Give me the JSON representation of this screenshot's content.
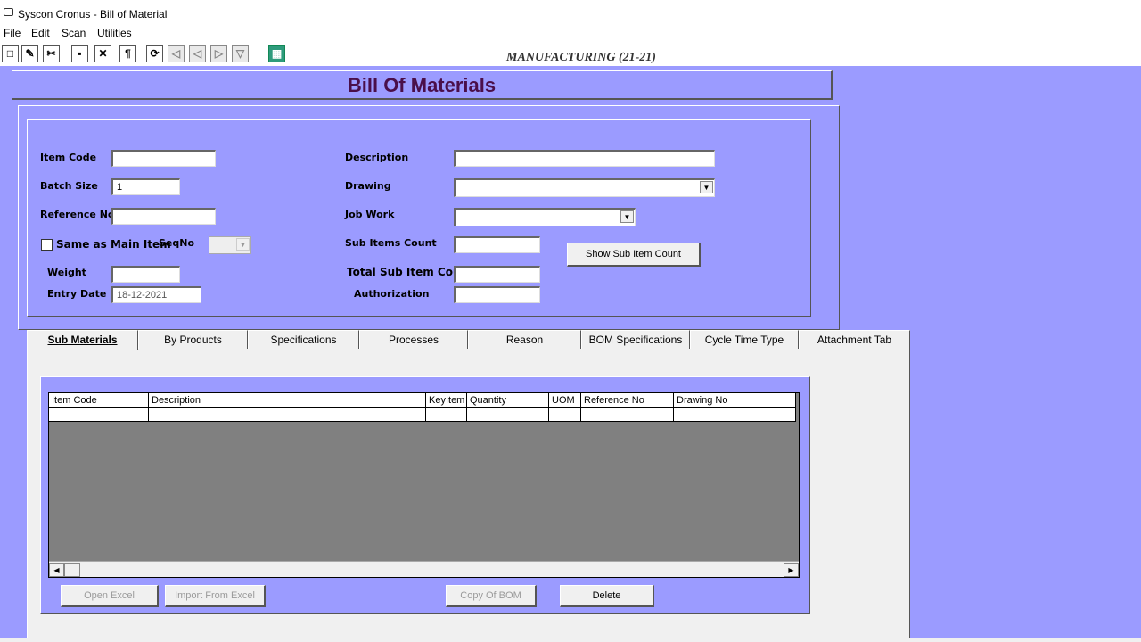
{
  "window": {
    "title": "Syscon Cronus - Bill  of Material",
    "minimize": "–"
  },
  "menu": [
    "File",
    "Edit",
    "Scan",
    "Utilities"
  ],
  "toolbar": {
    "icons": [
      "new-icon",
      "open-icon",
      "cut-icon",
      "save-icon",
      "close-icon",
      "paragraph-icon",
      "refresh-icon",
      "first-icon",
      "prev-icon",
      "next-icon",
      "last-icon",
      "calculator-icon"
    ],
    "mode_text": "MANUFACTURING (21-21)"
  },
  "header": {
    "title": "Bill Of Materials"
  },
  "form": {
    "item_code_label": "Item Code",
    "item_code_value": "",
    "batch_size_label": "Batch Size",
    "batch_size_value": "1",
    "reference_no_label": "Reference No.",
    "reference_no_value": "",
    "same_as_main_label": "Same as Main Item",
    "seqno_label": "SeqNo",
    "weight_label": "Weight",
    "weight_value": "",
    "entry_date_label": "Entry Date",
    "entry_date_value": "18-12-2021",
    "description_label": "Description",
    "description_value": "",
    "drawing_label": "Drawing",
    "drawing_value": "",
    "job_work_label": "Job Work",
    "job_work_value": "",
    "sub_items_count_label": "Sub Items Count",
    "sub_items_count_value": "",
    "total_sub_item_count_label": "Total Sub Item Count",
    "total_sub_item_count_value": "",
    "authorization_label": "Authorization",
    "authorization_value": "",
    "show_sub_item_count_button": "Show Sub Item Count"
  },
  "tabs": [
    {
      "label": "Sub Materials",
      "active": true
    },
    {
      "label": "By Products"
    },
    {
      "label": "Specifications"
    },
    {
      "label": "Processes"
    },
    {
      "label": "Reason"
    },
    {
      "label": "BOM Specifications"
    },
    {
      "label": "Cycle Time Type"
    },
    {
      "label": "Attachment Tab"
    }
  ],
  "grid": {
    "columns": [
      "Item Code",
      "Description",
      "KeyItem",
      "Quantity",
      "UOM",
      "Reference No",
      "Drawing No"
    ],
    "rows": [
      [
        "",
        "",
        "",
        "",
        "",
        "",
        ""
      ]
    ]
  },
  "buttons": {
    "open_excel": "Open Excel",
    "import_from_excel": "Import From Excel",
    "copy_of_bom": "Copy Of BOM",
    "delete": "Delete"
  },
  "colors": {
    "background": "#9b9bff",
    "title_text": "#4a0f4a",
    "grid_empty": "#808080"
  }
}
